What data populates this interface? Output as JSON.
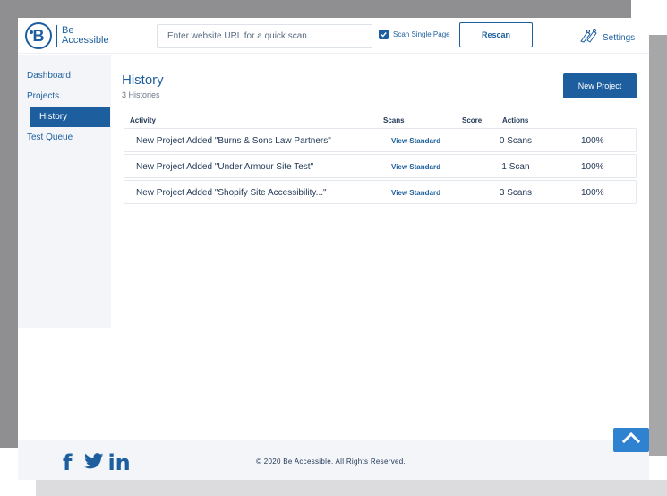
{
  "header": {
    "logo_line1": "Be",
    "logo_line2": "Accessible",
    "logo_letter": "B",
    "url_placeholder": "Enter website URL for a quick scan...",
    "scan_single_page_label": "Scan Single Page",
    "scan_single_page_checked": true,
    "rescan_label": "Rescan",
    "settings_label": "Settings"
  },
  "sidebar": {
    "items": [
      {
        "label": "Dashboard",
        "active": false
      },
      {
        "label": "Projects",
        "active": false
      },
      {
        "label": "History",
        "active": true
      },
      {
        "label": "Test Queue",
        "active": false
      }
    ]
  },
  "main": {
    "title": "History",
    "subtitle": "3 Histories",
    "new_project_label": "New Project",
    "columns": {
      "activity": "Activity",
      "scans": "Scans",
      "score": "Score",
      "actions": "Actions"
    },
    "rows": [
      {
        "activity": "New Project Added \"Burns & Sons Law Partners\"",
        "view": "View Standard",
        "scans": "0 Scans",
        "score": "100%"
      },
      {
        "activity": "New Project Added \"Under Armour Site Test\"",
        "view": "View Standard",
        "scans": "1 Scan",
        "score": "100%"
      },
      {
        "activity": "New Project Added \"Shopify Site Accessibility...\"",
        "view": "View Standard",
        "scans": "3 Scans",
        "score": "100%"
      }
    ]
  },
  "footer": {
    "social": [
      "facebook-icon",
      "twitter-icon",
      "linkedin-icon"
    ],
    "facebook_glyph": "f",
    "linkedin_glyph": "in",
    "copyright": "© 2020 Be Accessible. All Rights Reserved."
  },
  "colors": {
    "brand": "#1d5f9e",
    "scroll_top": "#2f82cf",
    "text_dark": "#1f3654"
  }
}
